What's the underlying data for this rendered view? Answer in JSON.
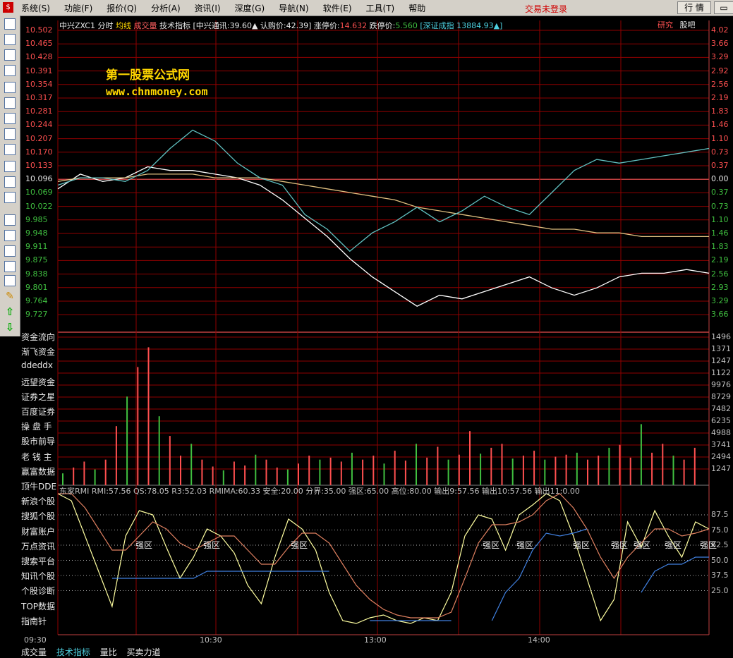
{
  "menu": [
    "系统(S)",
    "功能(F)",
    "报价(Q)",
    "分析(A)",
    "资讯(I)",
    "深度(G)",
    "导航(N)",
    "软件(E)",
    "工具(T)",
    "帮助"
  ],
  "trade_status": "交易未登录",
  "quote_button": "行 情",
  "header": {
    "stock": "中兴ZXC1",
    "tab1": "分时",
    "tab2": "均线",
    "tab3": "成交量",
    "tab4": "技术指标",
    "info": "[中兴通讯:39.60▲ 认购价:42.39]",
    "limit_up_label": "涨停价:",
    "limit_up": "14.632",
    "limit_down_label": "跌停价:",
    "limit_down": "5.560",
    "index": "[深证成指 13884.93▲]"
  },
  "right_links": {
    "research": "研究",
    "forum": "股吧"
  },
  "watermark": {
    "line1": "第一股票公式网",
    "line2": "www.chnmoney.com"
  },
  "price_axis_left": [
    "10.502",
    "10.465",
    "10.428",
    "10.391",
    "10.354",
    "10.317",
    "10.281",
    "10.244",
    "10.207",
    "10.170",
    "10.133",
    "10.096",
    "10.069",
    "10.022",
    "9.985",
    "9.948",
    "9.911",
    "9.875",
    "9.838",
    "9.801",
    "9.764",
    "9.727"
  ],
  "price_axis_right": [
    "4.02",
    "3.66",
    "3.29",
    "2.92",
    "2.56",
    "2.19",
    "1.83",
    "1.46",
    "1.10",
    "0.73",
    "0.37",
    "0.00",
    "0.37",
    "0.73",
    "1.10",
    "1.46",
    "1.83",
    "2.19",
    "2.56",
    "2.93",
    "3.29",
    "3.66"
  ],
  "volume_axis": [
    "1496",
    "1371",
    "1247",
    "1122",
    "9976",
    "8729",
    "7482",
    "6235",
    "4988",
    "3741",
    "2494",
    "1247"
  ],
  "osc_axis": [
    "87.5",
    "75.0",
    "62.5",
    "50.0",
    "37.5",
    "25.0"
  ],
  "left_menu": [
    "资金流向",
    "渐飞资金",
    "ddeddx",
    "远望资金",
    "证券之星",
    "百度证券",
    "操 盘 手",
    "股市前导",
    "老 钱 主",
    "赢富数据",
    "顶牛DDE",
    "新浪个股",
    "搜狐个股",
    "财富账户",
    "万点资讯",
    "搜索平台",
    "知讯个股",
    "个股诊断",
    "TOP数据",
    "指南针"
  ],
  "osc_header": "东家RMI RMI:57.56 QS:78.05 R3:52.03 RMIMA:60.33 安全:20.00 分界:35.00 强区:65.00 高位:80.00 输出9:57.56 输出10:57.56 输出11:0.00",
  "zone_label": "强区",
  "time_axis": [
    "09:30",
    "10:30",
    "13:00",
    "14:00"
  ],
  "bottom_tabs": [
    "成交量",
    "技术指标",
    "量比",
    "买卖力道"
  ],
  "colors": {
    "up": "#ff5050",
    "down": "#40c040",
    "grid": "#900000",
    "price_line": "#ffffff",
    "avg_line": "#e0c080",
    "index_line": "#60c0c0",
    "header_blue": "#4dd0e0"
  },
  "chart_data": [
    {
      "type": "line",
      "title": "中兴ZXC1 分时",
      "x": [
        "09:30",
        "10:30",
        "13:00",
        "14:00"
      ],
      "ylim": [
        9.727,
        10.502
      ],
      "series": [
        {
          "name": "分时",
          "values": [
            10.07,
            10.11,
            10.09,
            10.1,
            10.13,
            10.12,
            10.12,
            10.11,
            10.1,
            10.08,
            10.04,
            9.99,
            9.94,
            9.88,
            9.83,
            9.79,
            9.75,
            9.78,
            9.77,
            9.79,
            9.81,
            9.83,
            9.8,
            9.78,
            9.8,
            9.83,
            9.84,
            9.84,
            9.85,
            9.84
          ]
        },
        {
          "name": "均线",
          "values": [
            10.09,
            10.1,
            10.1,
            10.1,
            10.11,
            10.11,
            10.11,
            10.1,
            10.1,
            10.1,
            10.09,
            10.08,
            10.07,
            10.06,
            10.05,
            10.04,
            10.02,
            10.01,
            10.0,
            9.99,
            9.98,
            9.97,
            9.96,
            9.96,
            9.95,
            9.95,
            9.94,
            9.94,
            9.94,
            9.94
          ]
        },
        {
          "name": "深证成指",
          "values": [
            10.08,
            10.1,
            10.1,
            10.09,
            10.12,
            10.18,
            10.23,
            10.2,
            10.14,
            10.1,
            10.08,
            10.0,
            9.96,
            9.9,
            9.95,
            9.98,
            10.02,
            9.98,
            10.01,
            10.05,
            10.02,
            10.0,
            10.06,
            10.12,
            10.15,
            10.14,
            10.15,
            10.16,
            10.17,
            10.18
          ]
        }
      ]
    },
    {
      "type": "bar",
      "title": "成交量",
      "ylim": [
        0,
        1496
      ],
      "values": [
        120,
        180,
        240,
        160,
        260,
        600,
        900,
        1200,
        1400,
        700,
        500,
        300,
        420,
        260,
        190,
        150,
        240,
        200,
        310,
        260,
        180,
        160,
        220,
        300,
        260,
        280,
        240,
        330,
        260,
        300,
        220,
        350,
        250,
        420,
        280,
        390,
        260,
        310,
        550,
        320,
        380,
        420,
        270,
        300,
        350,
        260,
        290,
        310,
        330,
        260,
        300,
        380,
        410,
        280,
        620,
        330,
        420,
        300,
        260,
        380
      ]
    },
    {
      "type": "line",
      "title": "东家RMI",
      "ylim": [
        0,
        100
      ],
      "series": [
        {
          "name": "RMI",
          "values": [
            100,
            95,
            70,
            45,
            20,
            70,
            88,
            85,
            62,
            40,
            55,
            75,
            70,
            58,
            35,
            22,
            55,
            82,
            75,
            60,
            30,
            10,
            8,
            12,
            14,
            10,
            8,
            12,
            10,
            30,
            70,
            85,
            82,
            60,
            85,
            92,
            100,
            95,
            70,
            40,
            10,
            25,
            80,
            62,
            88,
            70,
            55,
            80,
            75
          ]
        },
        {
          "name": "RMIMA",
          "values": [
            100,
            100,
            90,
            75,
            60,
            60,
            70,
            80,
            75,
            65,
            60,
            65,
            70,
            70,
            60,
            50,
            50,
            62,
            72,
            72,
            65,
            50,
            35,
            25,
            18,
            14,
            12,
            12,
            12,
            16,
            40,
            65,
            78,
            78,
            80,
            85,
            95,
            100,
            90,
            75,
            55,
            40,
            55,
            65,
            75,
            75,
            70,
            72,
            75
          ]
        },
        {
          "name": "安全",
          "values": [
            null,
            null,
            null,
            null,
            40,
            40,
            40,
            40,
            40,
            40,
            40,
            45,
            45,
            45,
            45,
            45,
            45,
            45,
            45,
            45,
            45,
            null,
            null,
            10,
            10,
            10,
            10,
            10,
            10,
            10,
            null,
            null,
            10,
            30,
            40,
            60,
            72,
            70,
            72,
            75,
            null,
            null,
            null,
            30,
            45,
            50,
            50,
            55,
            55
          ]
        }
      ]
    }
  ]
}
